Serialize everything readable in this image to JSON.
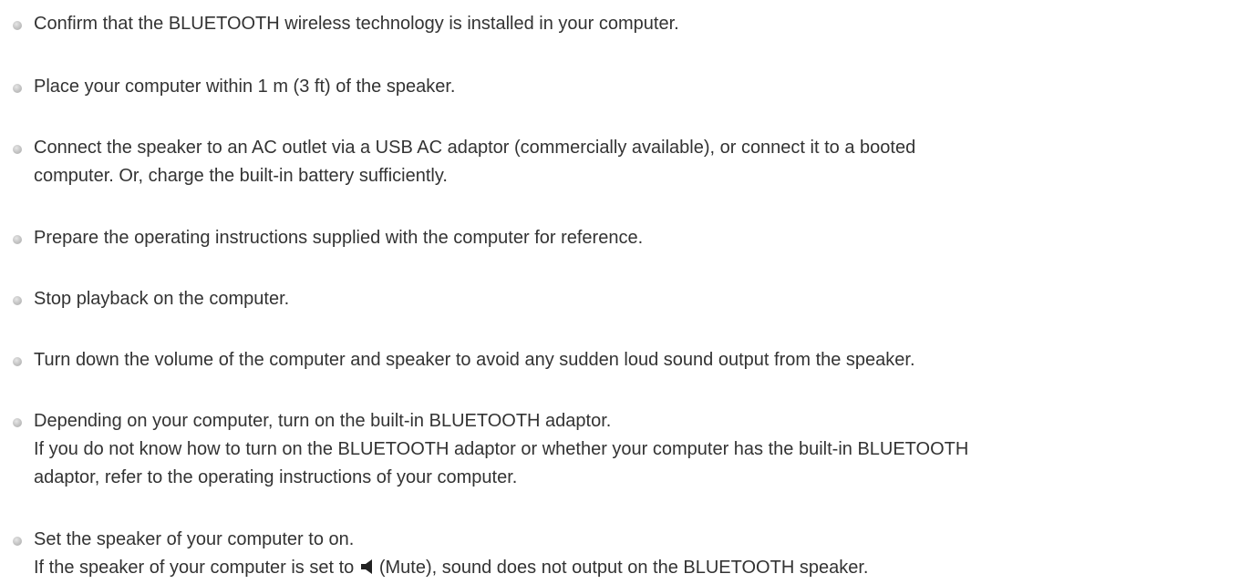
{
  "items": [
    {
      "lines": [
        "Confirm that the BLUETOOTH wireless technology is installed in your computer."
      ]
    },
    {
      "lines": [
        "Place your computer within 1 m (3 ft) of the speaker."
      ]
    },
    {
      "lines": [
        "Connect the speaker to an AC outlet via a USB AC adaptor (commercially available), or connect it to a booted",
        "computer. Or, charge the built-in battery sufficiently."
      ]
    },
    {
      "lines": [
        "Prepare the operating instructions supplied with the computer for reference."
      ]
    },
    {
      "lines": [
        "Stop playback on the computer."
      ]
    },
    {
      "lines": [
        "Turn down the volume of the computer and speaker to avoid any sudden loud sound output from the speaker."
      ]
    },
    {
      "lines": [
        "Depending on your computer, turn on the built-in BLUETOOTH adaptor.",
        "If you do not know how to turn on the BLUETOOTH adaptor or whether your computer has the built-in BLUETOOTH",
        "adaptor, refer to the operating instructions of your computer."
      ]
    },
    {
      "lines": [
        "Set the speaker of your computer to on."
      ],
      "mute_before": "If the speaker of your computer is set to",
      "mute_after": "(Mute), sound does not output on the BLUETOOTH speaker."
    }
  ],
  "icons": {
    "bullet": "bullet-dot-icon",
    "mute": "mute-speaker-icon"
  },
  "colors": {
    "text": "#333333",
    "bullet": "#bbbbbb",
    "icon": "#222222"
  }
}
